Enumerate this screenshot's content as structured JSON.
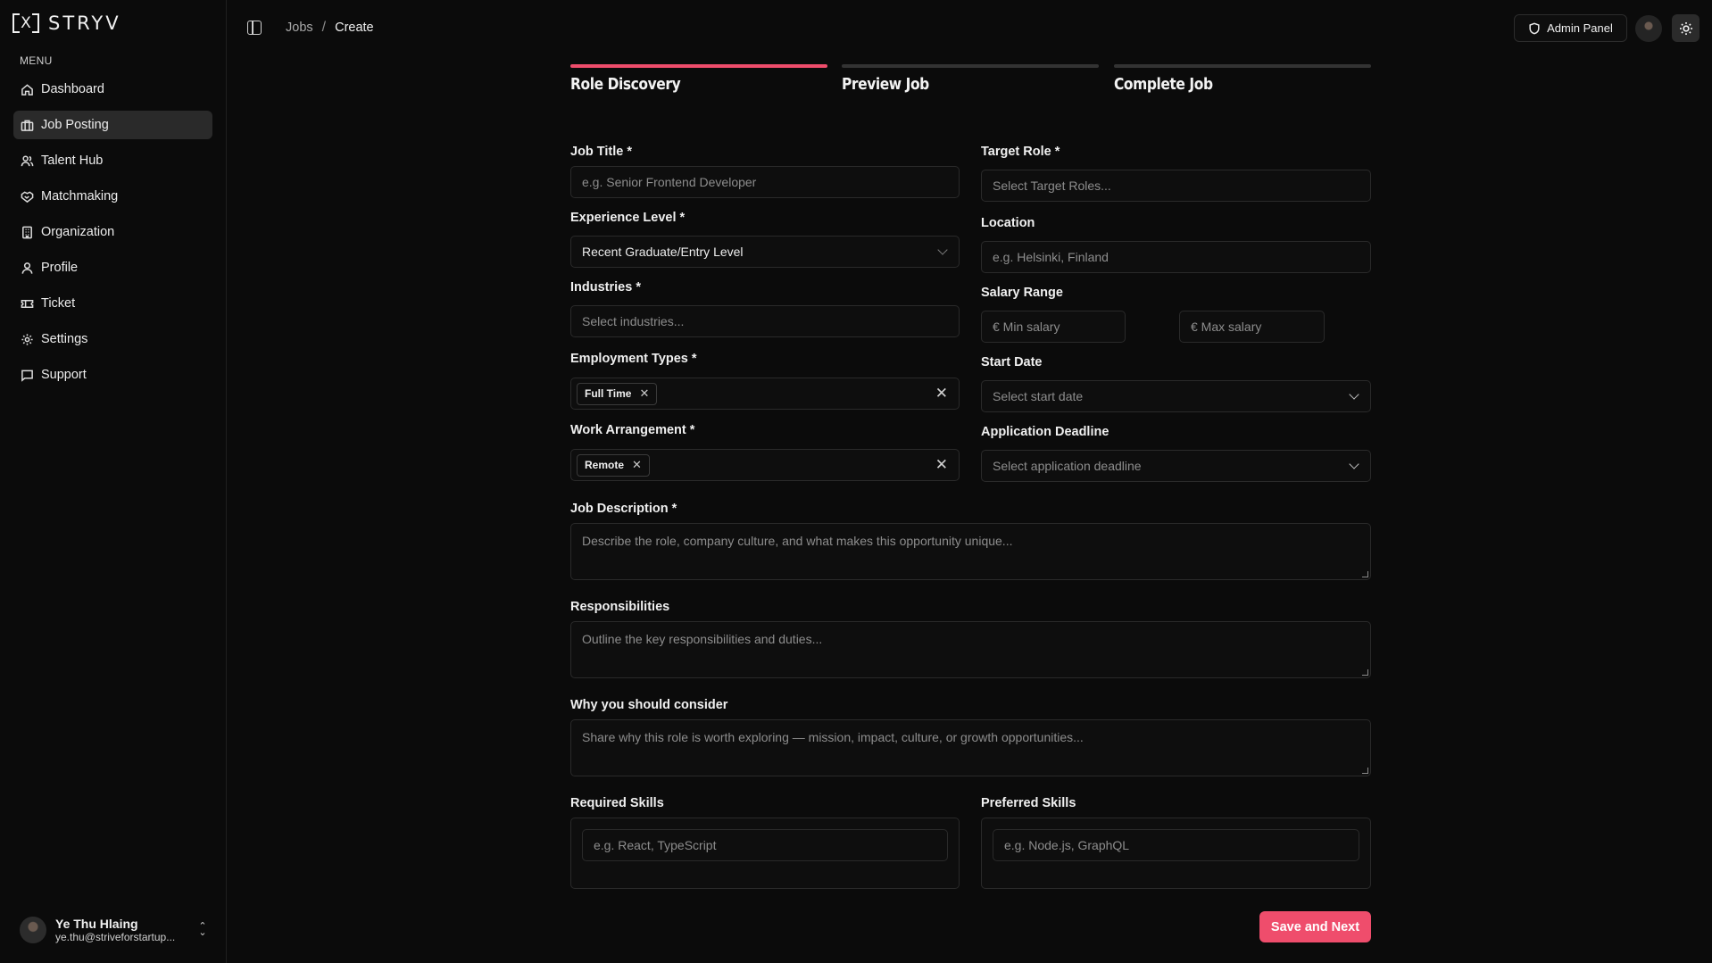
{
  "brand": {
    "name": "STRYV",
    "mark": "X"
  },
  "sidebar": {
    "menu_label": "MENU",
    "items": [
      {
        "label": "Dashboard",
        "icon": "home-icon"
      },
      {
        "label": "Job Posting",
        "icon": "briefcase-icon",
        "active": true
      },
      {
        "label": "Talent Hub",
        "icon": "users-icon"
      },
      {
        "label": "Matchmaking",
        "icon": "handshake-icon"
      },
      {
        "label": "Organization",
        "icon": "building-icon"
      },
      {
        "label": "Profile",
        "icon": "user-icon"
      },
      {
        "label": "Ticket",
        "icon": "ticket-icon"
      },
      {
        "label": "Settings",
        "icon": "gear-icon"
      },
      {
        "label": "Support",
        "icon": "message-icon"
      }
    ],
    "user": {
      "name": "Ye Thu Hlaing",
      "email": "ye.thu@striveforstartup..."
    }
  },
  "header": {
    "breadcrumb": {
      "parent": "Jobs",
      "separator": "/",
      "current": "Create"
    },
    "admin_label": "Admin Panel"
  },
  "steps": [
    {
      "label": "Role Discovery",
      "active": true
    },
    {
      "label": "Preview Job",
      "active": false
    },
    {
      "label": "Complete Job",
      "active": false
    }
  ],
  "form": {
    "job_title": {
      "label": "Job Title *",
      "placeholder": "e.g. Senior Frontend Developer"
    },
    "target_role": {
      "label": "Target Role *",
      "placeholder": "Select Target Roles..."
    },
    "experience": {
      "label": "Experience Level *",
      "value": "Recent Graduate/Entry Level"
    },
    "location": {
      "label": "Location",
      "placeholder": "e.g. Helsinki, Finland"
    },
    "industries": {
      "label": "Industries *",
      "placeholder": "Select industries..."
    },
    "salary": {
      "label": "Salary Range",
      "min_placeholder": "€ Min salary",
      "max_placeholder": "€ Max salary"
    },
    "employment": {
      "label": "Employment Types *",
      "chip": "Full Time"
    },
    "start_date": {
      "label": "Start Date",
      "placeholder": "Select start date"
    },
    "work_arrangement": {
      "label": "Work Arrangement *",
      "chip": "Remote"
    },
    "deadline": {
      "label": "Application Deadline",
      "placeholder": "Select application deadline"
    },
    "description": {
      "label": "Job Description *",
      "placeholder": "Describe the role, company culture, and what makes this opportunity unique..."
    },
    "responsibilities": {
      "label": "Responsibilities",
      "placeholder": "Outline the key responsibilities and duties..."
    },
    "why_consider": {
      "label": "Why you should consider",
      "placeholder": "Share why this role is worth exploring — mission, impact, culture, or growth opportunities..."
    },
    "required_skills": {
      "label": "Required Skills",
      "placeholder": "e.g. React, TypeScript"
    },
    "preferred_skills": {
      "label": "Preferred Skills",
      "placeholder": "e.g. Node.js, GraphQL"
    },
    "submit_label": "Save and Next"
  },
  "colors": {
    "accent": "#ef4d6c",
    "background": "#0b0b0b"
  }
}
